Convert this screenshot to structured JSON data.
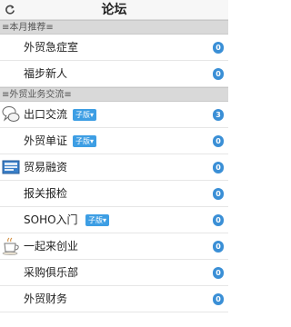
{
  "header": {
    "title": "论坛",
    "refresh_icon": "refresh-icon"
  },
  "sections": [
    {
      "label": "≡本月推荐≡"
    },
    {
      "label": "≡外贸业务交流≡"
    }
  ],
  "rows": [
    {
      "label": "外贸急症室",
      "count": "0"
    },
    {
      "label": "福步新人",
      "count": "0"
    },
    {
      "label": "出口交流",
      "badge": "子版",
      "count": "3",
      "icon": "chat-bubbles-icon"
    },
    {
      "label": "外贸单证",
      "badge": "子版",
      "count": "0"
    },
    {
      "label": "贸易融资",
      "count": "0",
      "icon": "document-stack-icon"
    },
    {
      "label": "报关报检",
      "count": "0"
    },
    {
      "label": "SOHO入门",
      "badge": "子版",
      "count": "0"
    },
    {
      "label": "一起来创业",
      "count": "0",
      "icon": "coffee-cup-icon"
    },
    {
      "label": "采购俱乐部",
      "count": "0"
    },
    {
      "label": "外贸财务",
      "count": "0"
    }
  ],
  "colors": {
    "count_badge": "#3a8fd6",
    "sub_badge": "#3d9ee4",
    "section_bg": "#d9d9d9"
  }
}
